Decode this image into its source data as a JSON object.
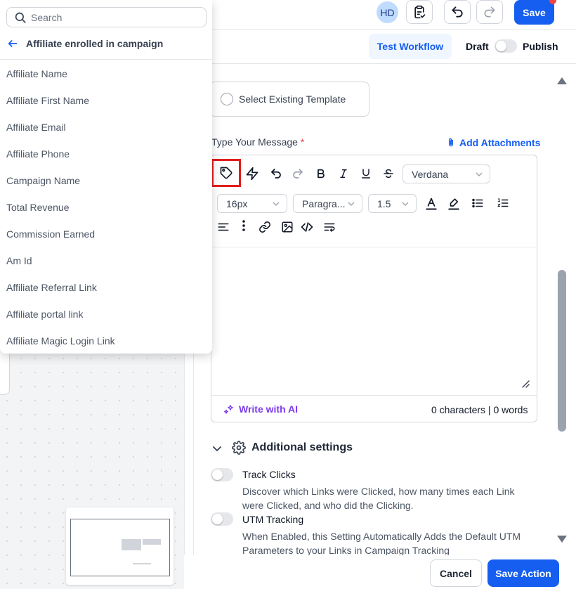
{
  "header": {
    "avatar_initials": "HD",
    "save_label": "Save",
    "test_workflow_label": "Test Workflow",
    "draft_label": "Draft",
    "publish_label": "Publish"
  },
  "action": {
    "template_option_label": "Select Existing Template",
    "message_label": "Type Your Message",
    "required_mark": "*",
    "add_attachments_label": "Add Attachments",
    "editor": {
      "font_family": "Verdana",
      "font_size": "16px",
      "block_format": "Paragra...",
      "line_height": "1.5",
      "write_ai_label": "Write with AI",
      "char_count": "0 characters | 0 words"
    },
    "additional_settings": {
      "title": "Additional settings",
      "settings": [
        {
          "title": "Track Clicks",
          "description": "Discover which Links were Clicked, how many times each Link were Clicked, and who did the Clicking.",
          "enabled": false
        },
        {
          "title": "UTM Tracking",
          "description": "When Enabled, this Setting Automatically Adds the Default UTM Parameters to your Links in Campaign Tracking",
          "enabled": false
        }
      ]
    },
    "cancel_label": "Cancel",
    "save_action_label": "Save Action"
  },
  "dropdown": {
    "search_placeholder": "Search",
    "back_title": "Affiliate enrolled in campaign",
    "items": [
      "Affiliate Name",
      "Affiliate First Name",
      "Affiliate Email",
      "Affiliate Phone",
      "Campaign Name",
      "Total Revenue",
      "Commission Earned",
      "Am Id",
      "Affiliate Referral Link",
      "Affiliate portal link",
      "Affiliate Magic Login Link"
    ]
  },
  "colors": {
    "primary": "#155eef",
    "ai_purple": "#7c3aed",
    "highlight_red": "#e11d1d",
    "required_red": "#ef4444"
  }
}
